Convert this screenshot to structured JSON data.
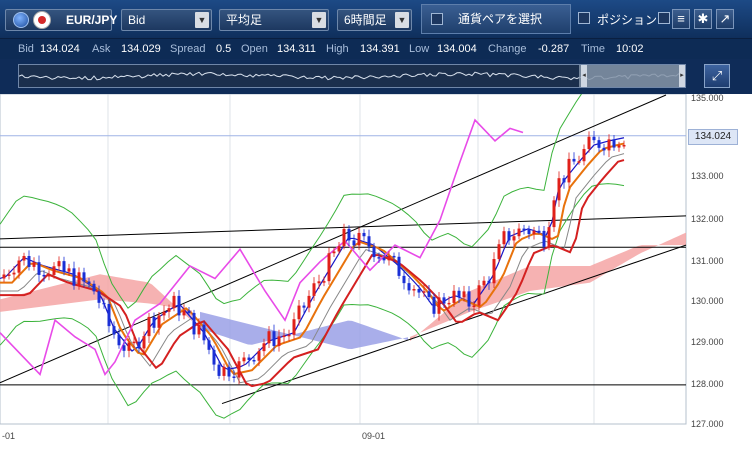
{
  "toolbar": {
    "pair": "EUR/JPY",
    "price_type": "Bid",
    "chart_type": "平均足",
    "timeframe": "6時間足",
    "select_pair_label": "通貨ペアを選択",
    "position_label": "ポジション",
    "menu_icon": "list-icon",
    "settings_icon": "gear-icon",
    "popout_icon": "popout-icon"
  },
  "quote": {
    "bid_label": "Bid",
    "bid": "134.024",
    "ask_label": "Ask",
    "ask": "134.029",
    "spread_label": "Spread",
    "spread": "0.5",
    "open_label": "Open",
    "open": "134.311",
    "high_label": "High",
    "high": "134.391",
    "low_label": "Low",
    "low": "134.004",
    "change_label": "Change",
    "change": "-0.287",
    "time_label": "Time",
    "time": "10:02"
  },
  "chart": {
    "y_labels": [
      "135.000",
      "134.024",
      "133.000",
      "132.000",
      "131.000",
      "130.000",
      "129.000",
      "128.000",
      "127.000"
    ],
    "current_price": "134.024",
    "x_labels": [
      "-01",
      "09-01"
    ],
    "colors": {
      "up": "#e0201a",
      "down": "#1a2fd6",
      "bollinger": "#3bb33b",
      "kumo_up": "#f4a4a4",
      "kumo_down": "#9aa0e6",
      "oscillator": "#e84be8",
      "ma_fast": "#1616c8",
      "ma_mid": "#e8720c",
      "ma_slow": "#d42020",
      "ma_grey": "#888888",
      "trendline": "#000000"
    }
  }
}
